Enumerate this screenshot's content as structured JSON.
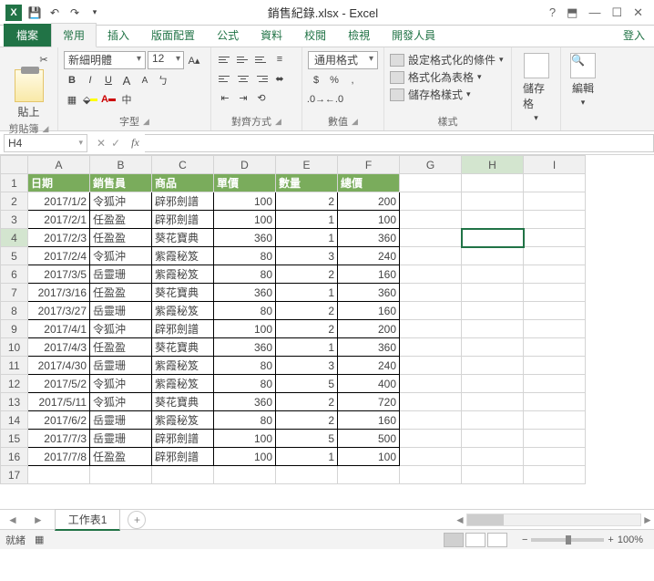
{
  "title": "銷售紀錄.xlsx - Excel",
  "login": "登入",
  "tabs": {
    "file": "檔案",
    "home": "常用",
    "insert": "插入",
    "layout": "版面配置",
    "formula": "公式",
    "data": "資料",
    "review": "校閱",
    "view": "檢視",
    "dev": "開發人員"
  },
  "ribbon": {
    "clipboard": {
      "paste": "貼上",
      "label": "剪貼簿"
    },
    "font": {
      "name": "新細明體",
      "size": "12",
      "label": "字型"
    },
    "align": {
      "wrap": "≡",
      "merge": "⬌",
      "label": "對齊方式"
    },
    "number": {
      "format": "通用格式",
      "label": "數值"
    },
    "styles": {
      "cond": "設定格式化的條件",
      "table": "格式化為表格",
      "cell": "儲存格樣式",
      "label": "樣式"
    },
    "cells": {
      "label": "儲存格",
      "btn": "儲存格"
    },
    "editing": {
      "label": "編輯",
      "btn": "編輯"
    }
  },
  "namebox": "H4",
  "columns": [
    "A",
    "B",
    "C",
    "D",
    "E",
    "F",
    "G",
    "H",
    "I"
  ],
  "headers": [
    "日期",
    "銷售員",
    "商品",
    "單價",
    "數量",
    "總價"
  ],
  "rows": [
    [
      "2017/1/2",
      "令狐沖",
      "辟邪劍譜",
      "100",
      "2",
      "200"
    ],
    [
      "2017/2/1",
      "任盈盈",
      "辟邪劍譜",
      "100",
      "1",
      "100"
    ],
    [
      "2017/2/3",
      "任盈盈",
      "葵花寶典",
      "360",
      "1",
      "360"
    ],
    [
      "2017/2/4",
      "令狐沖",
      "紫霞秘笈",
      "80",
      "3",
      "240"
    ],
    [
      "2017/3/5",
      "岳靈珊",
      "紫霞秘笈",
      "80",
      "2",
      "160"
    ],
    [
      "2017/3/16",
      "任盈盈",
      "葵花寶典",
      "360",
      "1",
      "360"
    ],
    [
      "2017/3/27",
      "岳靈珊",
      "紫霞秘笈",
      "80",
      "2",
      "160"
    ],
    [
      "2017/4/1",
      "令狐沖",
      "辟邪劍譜",
      "100",
      "2",
      "200"
    ],
    [
      "2017/4/3",
      "任盈盈",
      "葵花寶典",
      "360",
      "1",
      "360"
    ],
    [
      "2017/4/30",
      "岳靈珊",
      "紫霞秘笈",
      "80",
      "3",
      "240"
    ],
    [
      "2017/5/2",
      "令狐沖",
      "紫霞秘笈",
      "80",
      "5",
      "400"
    ],
    [
      "2017/5/11",
      "令狐沖",
      "葵花寶典",
      "360",
      "2",
      "720"
    ],
    [
      "2017/6/2",
      "岳靈珊",
      "紫霞秘笈",
      "80",
      "2",
      "160"
    ],
    [
      "2017/7/3",
      "岳靈珊",
      "辟邪劍譜",
      "100",
      "5",
      "500"
    ],
    [
      "2017/7/8",
      "任盈盈",
      "辟邪劍譜",
      "100",
      "1",
      "100"
    ]
  ],
  "sheet": "工作表1",
  "status": {
    "ready": "就緒",
    "zoom": "100%"
  }
}
